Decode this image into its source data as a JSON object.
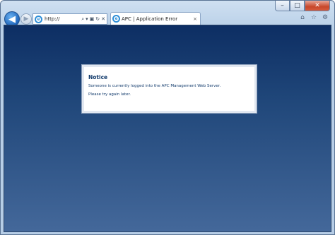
{
  "browser": {
    "address_value": "http://",
    "tab_title": "APC | Application Error",
    "tab_close_glyph": "×",
    "caption": {
      "minimize": "–",
      "maximize": "□",
      "close": "✕"
    }
  },
  "page": {
    "notice_title": "Notice",
    "notice_line1": "Someone is currently logged into the APC Management Web Server.",
    "notice_line2": "Please try again later."
  },
  "colors": {
    "background_top": "#0d2e63",
    "background_bottom": "#44689a",
    "text": "#123b6c"
  }
}
